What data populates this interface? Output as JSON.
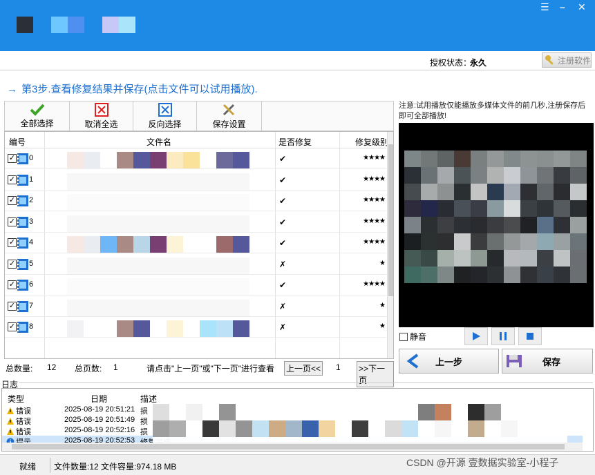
{
  "header": {
    "auth_label": "授权状态：",
    "auth_value": "永久",
    "register_label": "注册软件"
  },
  "step_text": "第3步.查看修复结果并保存(点击文件可以试用播放).",
  "toolbar": [
    {
      "label": "全部选择",
      "icon": "check-icon"
    },
    {
      "label": "取消全选",
      "icon": "red-x-icon"
    },
    {
      "label": "反向选择",
      "icon": "blue-x-icon"
    },
    {
      "label": "保存设置",
      "icon": "tools-icon"
    }
  ],
  "grid": {
    "headers": {
      "num": "编号",
      "name": "文件名",
      "fixed": "是否修复",
      "level": "修复级别"
    },
    "rows": [
      {
        "num": "0",
        "fixed": "✔",
        "level": "★★★★"
      },
      {
        "num": "1",
        "fixed": "✔",
        "level": "★★★★"
      },
      {
        "num": "2",
        "fixed": "✔",
        "level": "★★★★"
      },
      {
        "num": "3",
        "fixed": "✔",
        "level": "★★★★"
      },
      {
        "num": "4",
        "fixed": "✔",
        "level": "★★★★"
      },
      {
        "num": "5",
        "fixed": "✗",
        "level": "★"
      },
      {
        "num": "6",
        "fixed": "✔",
        "level": "★★★★"
      },
      {
        "num": "7",
        "fixed": "✗",
        "level": "★"
      },
      {
        "num": "8",
        "fixed": "✗",
        "level": "★"
      }
    ]
  },
  "pager": {
    "total_label": "总数量:",
    "total": "12",
    "pages_label": "总页数:",
    "pages": "1",
    "hint": "请点击\"上一页\"或\"下一页\"进行查看",
    "prev": "上一页<<",
    "page": "1",
    "next": ">>下一页"
  },
  "preview": {
    "note": "注意:试用播放仅能播放多媒体文件的前几秒,注册保存后即可全部播放!",
    "mute_label": "静音"
  },
  "buttons": {
    "back": "上一步",
    "save": "保存"
  },
  "log": {
    "title": "日志",
    "headers": {
      "type": "类型",
      "date": "日期",
      "desc": "描述"
    },
    "rows": [
      {
        "type": "错误",
        "date": "2025-08-19 20:51:21",
        "desc": "损",
        "icon": "warning-icon"
      },
      {
        "type": "错误",
        "date": "2025-08-19 20:51:49",
        "desc": "损",
        "icon": "warning-icon"
      },
      {
        "type": "错误",
        "date": "2025-08-19 20:52:16",
        "desc": "损",
        "icon": "warning-icon"
      },
      {
        "type": "提示",
        "date": "2025-08-19 20:52:53",
        "desc": "修复完成",
        "icon": "info-icon"
      }
    ]
  },
  "status": {
    "ready": "就绪",
    "info": "文件数量:12 文件容量:974.18 MB",
    "watermark": "CSDN @开源 壹数据实验室-小程子"
  },
  "colors": {
    "title_bar": "#1e8ae6",
    "link_blue": "#1e6fd0"
  }
}
